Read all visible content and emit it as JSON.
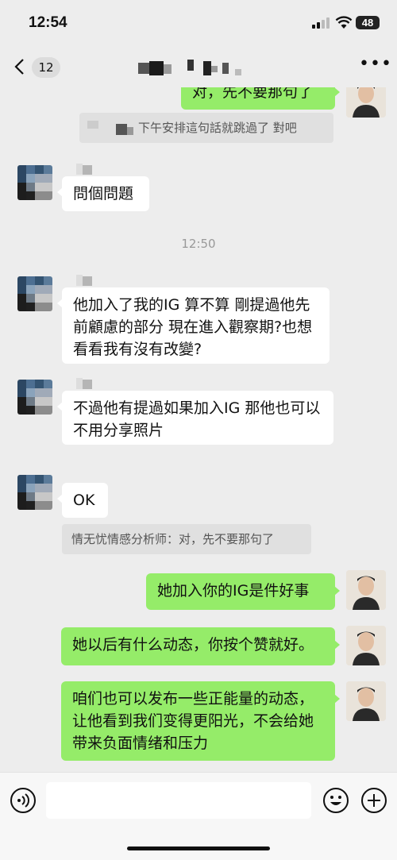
{
  "status": {
    "time": "12:54",
    "battery": "48"
  },
  "header": {
    "back_count": "12",
    "more": "•••"
  },
  "messages": {
    "top_right": "对，先不要那句了",
    "quote_top": "下午安排這句話就跳過了 對吧",
    "m1": "問個問題",
    "timestamp": "12:50",
    "m2": "他加入了我的IG  算不算  剛提過他先前顧慮的部分  現在進入觀察期?也想看看我有沒有改變?",
    "m3": "不過他有提過如果加入IG 那他也可以不用分享照片",
    "m4": "OK",
    "quote2": "情无忧情感分析师：对，先不要那句了",
    "r1": "她加入你的IG是件好事",
    "r2": "她以后有什么动态，你按个赞就好。",
    "r3": "咱们也可以发布一些正能量的动态，让他看到我们变得更阳光，不会给她带来负面情绪和压力"
  },
  "icons": {
    "signal": "signal-icon",
    "wifi": "wifi-icon",
    "back": "chevron-left-icon",
    "voice": "voice-icon",
    "emoji": "emoji-icon",
    "plus": "plus-icon"
  },
  "colors": {
    "sent_bubble": "#95ec69",
    "received_bubble": "#ffffff",
    "background": "#ededed"
  }
}
